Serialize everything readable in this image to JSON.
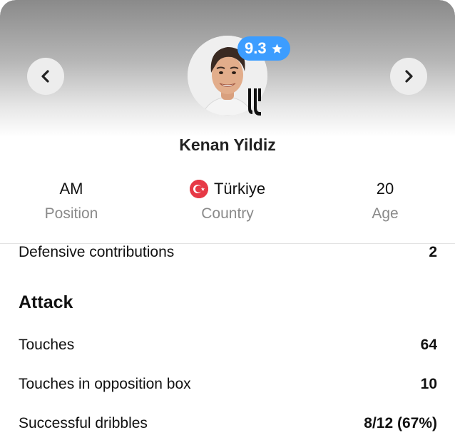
{
  "player": {
    "name": "Kenan Yildiz",
    "rating": "9.3",
    "rating_icon": "star-icon",
    "club_logo": "juventus-logo",
    "position": {
      "value": "AM",
      "label": "Position"
    },
    "country": {
      "value": "Türkiye",
      "label": "Country",
      "flag": "turkey-flag-icon"
    },
    "age": {
      "value": "20",
      "label": "Age"
    }
  },
  "stats": {
    "defensive_contributions": {
      "label": "Defensive contributions",
      "value": "2"
    },
    "attack": {
      "title": "Attack",
      "rows": [
        {
          "label": "Touches",
          "value": "64"
        },
        {
          "label": "Touches in opposition box",
          "value": "10"
        },
        {
          "label": "Successful dribbles",
          "value": "8/12 (67%)"
        }
      ]
    }
  },
  "colors": {
    "rating_badge": "#3c9dff",
    "label_gray": "#8a8a8a",
    "flag_red": "#e63946"
  }
}
